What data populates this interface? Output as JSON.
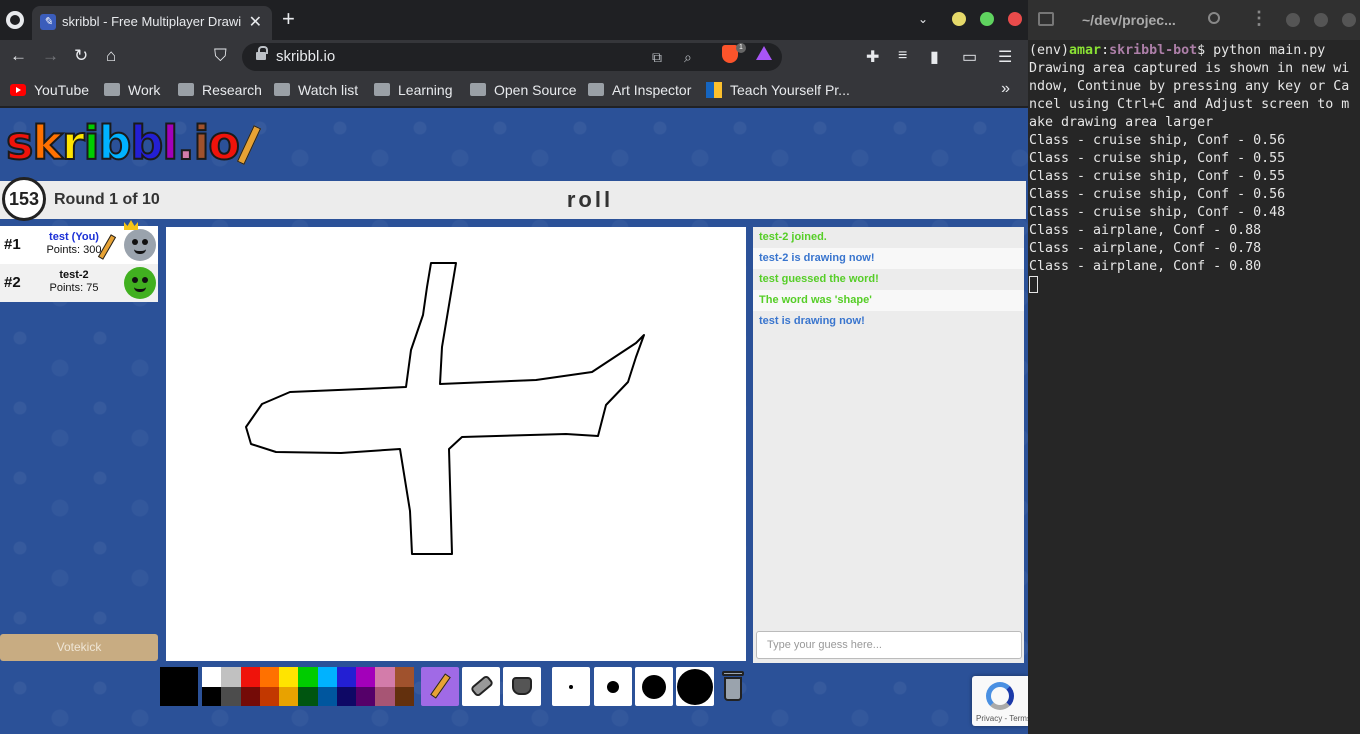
{
  "browser": {
    "tab_title": "skribbl - Free Multiplayer Drawing",
    "tab_close": "✕",
    "new_tab": "+",
    "url": "skribbl.io",
    "brave_badge": "1",
    "bookmarks": [
      {
        "label": "YouTube",
        "icon": "youtube-icon"
      },
      {
        "label": "Work",
        "icon": "folder-icon"
      },
      {
        "label": "Research",
        "icon": "folder-icon"
      },
      {
        "label": "Watch list",
        "icon": "folder-icon"
      },
      {
        "label": "Learning",
        "icon": "folder-icon"
      },
      {
        "label": "Open Source",
        "icon": "folder-icon"
      },
      {
        "label": "Art Inspector",
        "icon": "folder-icon"
      },
      {
        "label": "Teach Yourself Pr...",
        "icon": "teach-yourself-icon"
      }
    ],
    "bookmarks_more": "»"
  },
  "game": {
    "logo_letters": [
      "s",
      "k",
      "r",
      "i",
      "b",
      "b",
      "l",
      ".",
      "i",
      "o"
    ],
    "logo_colors": [
      "#ef130b",
      "#ff7100",
      "#ffe400",
      "#00cc00",
      "#00b2ff",
      "#231fd3",
      "#a300ba",
      "#d37caa",
      "#a0522d",
      "#ef130b"
    ],
    "timer": "153",
    "round": "Round 1 of 10",
    "word": "roll",
    "players": [
      {
        "rank": "#1",
        "name": "test (You)",
        "points": "Points: 300",
        "name_color": "#1b2fd6",
        "avatar_color": "#9aa3ad",
        "crown": true
      },
      {
        "rank": "#2",
        "name": "test-2",
        "points": "Points: 75",
        "name_color": "#111111",
        "avatar_color": "#41b020",
        "crown": false
      }
    ],
    "votekick": "Votekick",
    "chat": [
      {
        "text": "test-2 joined.",
        "kind": "green"
      },
      {
        "text": "test-2 is drawing now!",
        "kind": "blue"
      },
      {
        "text": "test guessed the word!",
        "kind": "green"
      },
      {
        "text": "The word was 'shape'",
        "kind": "green"
      },
      {
        "text": "test is drawing now!",
        "kind": "blue"
      }
    ],
    "guess_placeholder": "Type your guess here...",
    "current_color": "#000000",
    "palette_top": [
      "#ffffff",
      "#c1c1c1",
      "#ef130b",
      "#ff7100",
      "#ffe400",
      "#00cc00",
      "#00b2ff",
      "#231fd3",
      "#a300ba",
      "#d37caa",
      "#a0522d"
    ],
    "palette_bottom": [
      "#000000",
      "#4c4c4c",
      "#740b07",
      "#c23800",
      "#e8a200",
      "#005510",
      "#00569e",
      "#0e0865",
      "#550069",
      "#a75574",
      "#63300d"
    ],
    "recaptcha_text": "Privacy - Terms"
  },
  "terminal": {
    "title": "~/dev/projec...",
    "prompt_env": "(env)",
    "prompt_user": "amar",
    "prompt_sep": ":",
    "prompt_path": "skribbl-bot",
    "prompt_cmd": "$ python main.py",
    "lines": [
      "Drawing area captured is shown in new window, Continue by pressing any key or Cancel using Ctrl+C and Adjust screen to make drawing area larger",
      "Class - cruise ship, Conf - 0.56",
      "Class - cruise ship, Conf - 0.55",
      "Class - cruise ship, Conf - 0.55",
      "Class - cruise ship, Conf - 0.56",
      "Class - cruise ship, Conf - 0.48",
      "Class - airplane, Conf - 0.88",
      "Class - airplane, Conf - 0.78",
      "Class - airplane, Conf - 0.80"
    ]
  }
}
